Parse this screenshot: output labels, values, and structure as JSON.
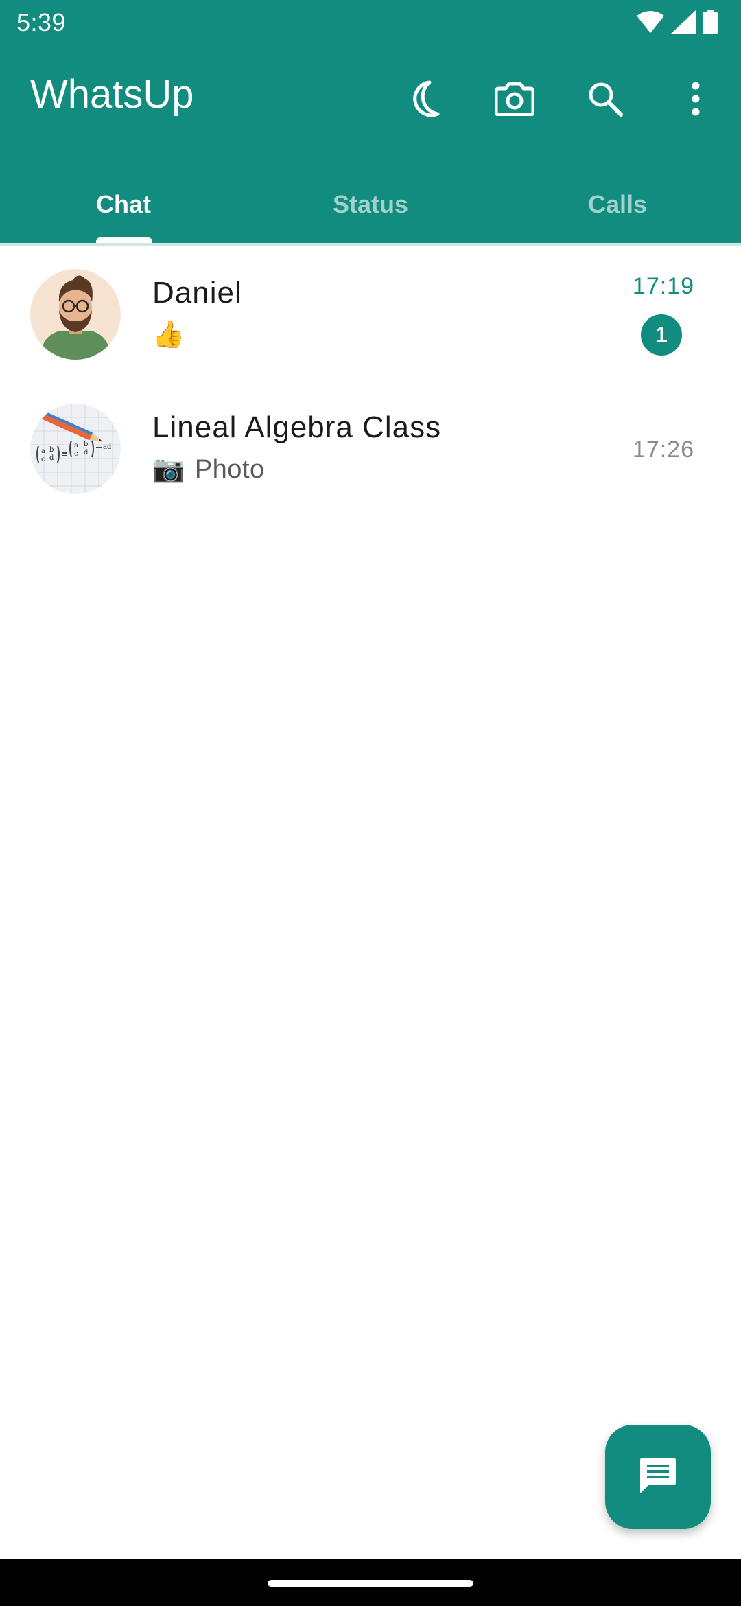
{
  "status_bar": {
    "time": "5:39",
    "icons": [
      "wifi-icon",
      "signal-icon",
      "battery-icon"
    ]
  },
  "app_bar": {
    "title": "WhatsUp",
    "actions": [
      "dark-mode-icon",
      "camera-icon",
      "search-icon",
      "more-vert-icon"
    ],
    "background_color": "#128c7e"
  },
  "tabs": [
    {
      "label": "Chat",
      "active": true
    },
    {
      "label": "Status",
      "active": false
    },
    {
      "label": "Calls",
      "active": false
    }
  ],
  "chats": [
    {
      "name": "Daniel",
      "preview": "👍",
      "time": "17:19",
      "unread_count": "1",
      "avatar": "man-with-glasses-avatar",
      "time_color": "#128c7e"
    },
    {
      "name": "Lineal Algebra Class",
      "preview_icon": "📷",
      "preview": "Photo",
      "time": "17:26",
      "avatar": "math-notebook-avatar",
      "time_color": "#8a8a8a"
    }
  ],
  "fab": {
    "icon": "new-chat-icon"
  }
}
